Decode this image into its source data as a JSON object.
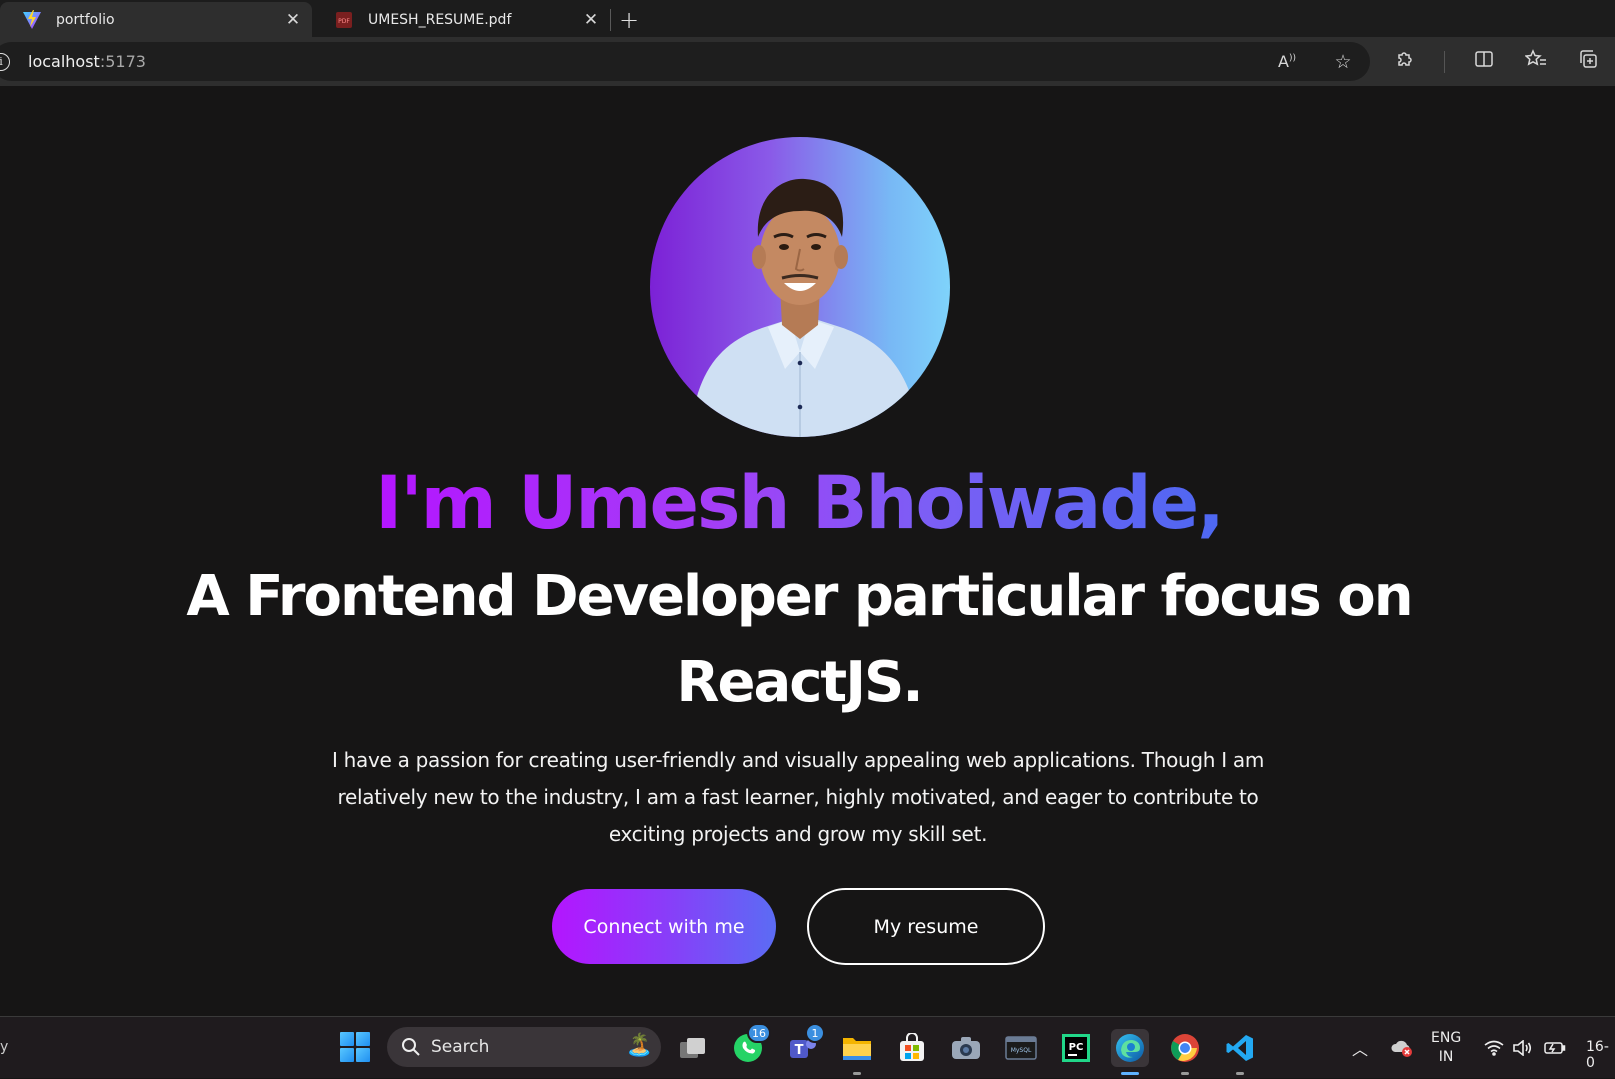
{
  "browser": {
    "tabs": [
      {
        "title": "portfolio",
        "active": true
      },
      {
        "title": "UMESH_RESUME.pdf",
        "active": false
      }
    ],
    "address": {
      "host": "localhost",
      "port": ":5173"
    }
  },
  "hero": {
    "name_line": "I'm Umesh Bhoiwade,",
    "subtitle_line1": "A Frontend Developer particular focus on",
    "subtitle_line2": "ReactJS.",
    "description": "I have a passion for creating user-friendly and visually appealing web applications. Though I am relatively new to the industry, I am a fast learner, highly motivated, and eager to contribute to exciting projects and grow my skill set.",
    "primary_button": "Connect with me",
    "secondary_button": "My resume",
    "colors": {
      "gradient_start": "#b415ff",
      "gradient_end": "#4d68f2",
      "background": "#161515"
    }
  },
  "taskbar": {
    "left_text": "y",
    "search_placeholder": "Search",
    "whatsapp_badge": "16",
    "teams_badge": "1",
    "lang_line1": "ENG",
    "lang_line2": "IN",
    "clock": "16-0"
  }
}
